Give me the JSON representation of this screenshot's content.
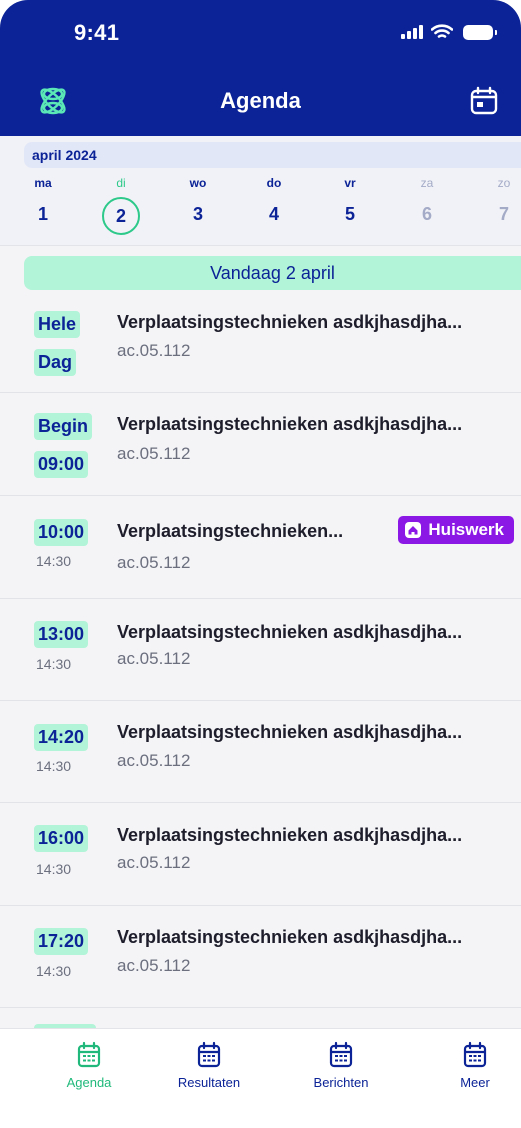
{
  "status_bar": {
    "time": "9:41"
  },
  "header": {
    "title": "Agenda"
  },
  "week": {
    "month": "april 2024",
    "days": [
      {
        "name": "ma",
        "date": "1"
      },
      {
        "name": "di",
        "date": "2"
      },
      {
        "name": "wo",
        "date": "3"
      },
      {
        "name": "do",
        "date": "4"
      },
      {
        "name": "vr",
        "date": "5"
      },
      {
        "name": "za",
        "date": "6"
      },
      {
        "name": "zo",
        "date": "7"
      }
    ]
  },
  "today_label": "Vandaag 2 april",
  "events": [
    {
      "start": "Hele",
      "end": "Dag",
      "title": "Verplaatsingstechnieken asdkjhasdjha...",
      "room": "ac.05.112"
    },
    {
      "start": "Begin",
      "end": "09:00",
      "title": "Verplaatsingstechnieken asdkjhasdjha...",
      "room": "ac.05.112"
    },
    {
      "start": "10:00",
      "end": "14:30",
      "title": "Verplaatsingstechnieken...",
      "room": "ac.05.112",
      "badge": "Huiswerk"
    },
    {
      "start": "13:00",
      "end": "14:30",
      "title": "Verplaatsingstechnieken asdkjhasdjha...",
      "room": "ac.05.112"
    },
    {
      "start": "14:20",
      "end": "14:30",
      "title": "Verplaatsingstechnieken asdkjhasdjha...",
      "room": "ac.05.112"
    },
    {
      "start": "16:00",
      "end": "14:30",
      "title": "Verplaatsingstechnieken asdkjhasdjha...",
      "room": "ac.05.112"
    },
    {
      "start": "17:20",
      "end": "14:30",
      "title": "Verplaatsingstechnieken asdkjhasdjha...",
      "room": "ac.05.112"
    }
  ],
  "tabs": [
    {
      "label": "Agenda"
    },
    {
      "label": "Resultaten"
    },
    {
      "label": "Berichten"
    },
    {
      "label": "Meer"
    }
  ],
  "colors": {
    "brand_blue": "#0b2396",
    "accent_green": "#2dc98a",
    "mint": "#b2f4d8",
    "badge_purple": "#8c18e6"
  }
}
